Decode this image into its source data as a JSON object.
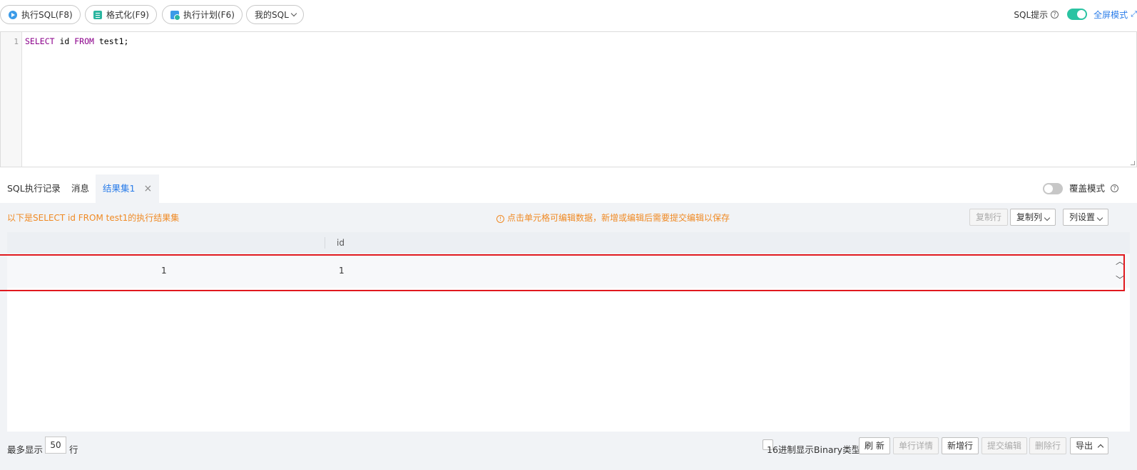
{
  "toolbar": {
    "run_label": "执行SQL(F8)",
    "format_label": "格式化(F9)",
    "plan_label": "执行计划(F6)",
    "my_sql_label": "我的SQL",
    "sql_hint_label": "SQL提示",
    "fullscreen_label": "全屏模式"
  },
  "editor": {
    "line_number": "1",
    "code_tokens": [
      "SELECT",
      " id ",
      "FROM",
      " test1;"
    ]
  },
  "tabs": {
    "history": "SQL执行记录",
    "messages": "消息",
    "result": "结果集1",
    "overwrite_label": "覆盖模式"
  },
  "result": {
    "summary": "以下是SELECT id FROM test1的执行结果集",
    "edit_hint": "点击单元格可编辑数据，新增或编辑后需要提交编辑以保存",
    "copy_row": "复制行",
    "copy_col": "复制列",
    "col_settings": "列设置",
    "columns": [
      "",
      "id"
    ],
    "rows": [
      [
        "1",
        "1"
      ]
    ]
  },
  "footer": {
    "max_show": "最多显示",
    "max_rows": "50",
    "rows_unit": "行",
    "hex_label": "16进制显示Binary类型",
    "refresh": "刷 新",
    "row_detail": "单行详情",
    "add_row": "新增行",
    "submit_edit": "提交编辑",
    "delete_row": "删除行",
    "export": "导出"
  }
}
